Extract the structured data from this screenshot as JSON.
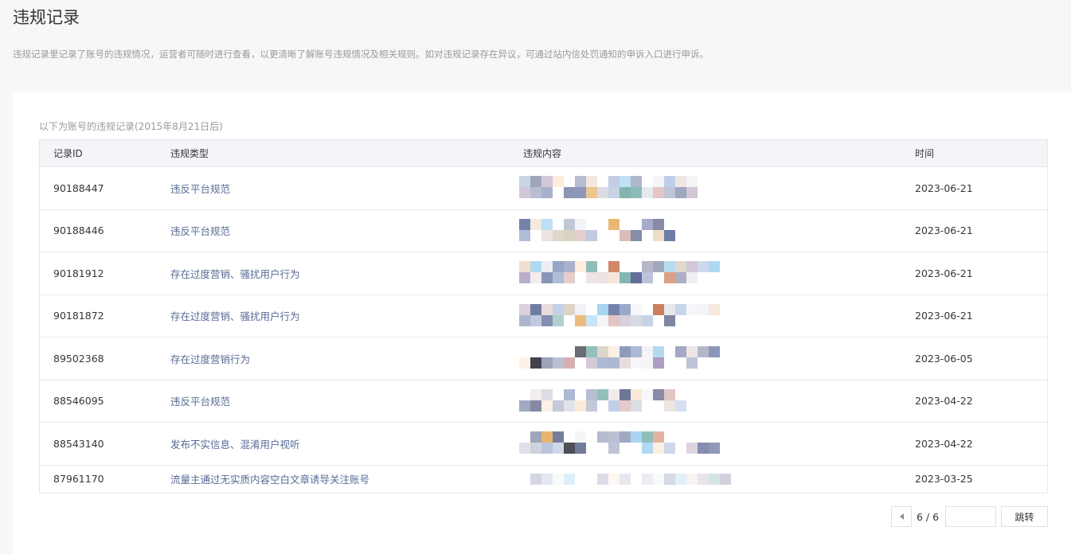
{
  "page": {
    "title": "违规记录",
    "description": "违规记录里记录了账号的违规情况，运营者可随时进行查看，以更清晰了解账号违规情况及相关规则。如对违规记录存在异议，可通过站内信处罚通知的申诉入口进行申诉。"
  },
  "table": {
    "caption": "以下为账号的违规记录(2015年8月21日后)",
    "headers": {
      "id": "记录ID",
      "type": "违规类型",
      "content": "违规内容",
      "time": "时间"
    },
    "rows": [
      {
        "id": "90188447",
        "type": "违反平台规范",
        "time": "2023-06-21"
      },
      {
        "id": "90188446",
        "type": "违反平台规范",
        "time": "2023-06-21"
      },
      {
        "id": "90181912",
        "type": "存在过度营销、骚扰用户行为",
        "time": "2023-06-21"
      },
      {
        "id": "90181872",
        "type": "存在过度营销、骚扰用户行为",
        "time": "2023-06-21"
      },
      {
        "id": "89502368",
        "type": "存在过度营销行为",
        "time": "2023-06-05"
      },
      {
        "id": "88546095",
        "type": "违反平台规范",
        "time": "2023-04-22"
      },
      {
        "id": "88543140",
        "type": "发布不实信息、混淆用户视听",
        "time": "2023-04-22"
      },
      {
        "id": "87961170",
        "type": "流量主通过无实质内容空白文章诱导关注账号",
        "time": "2023-03-25"
      }
    ]
  },
  "pager": {
    "page_text": "6 / 6",
    "input_value": "",
    "jump_label": "跳转",
    "prev_icon": "triangle-left-icon"
  },
  "colors": {
    "link": "#576b95",
    "header_bg": "#f4f5f9",
    "border": "#e7e7eb",
    "muted_text": "#9a9a9a",
    "page_bg": "#f6f7f9"
  }
}
